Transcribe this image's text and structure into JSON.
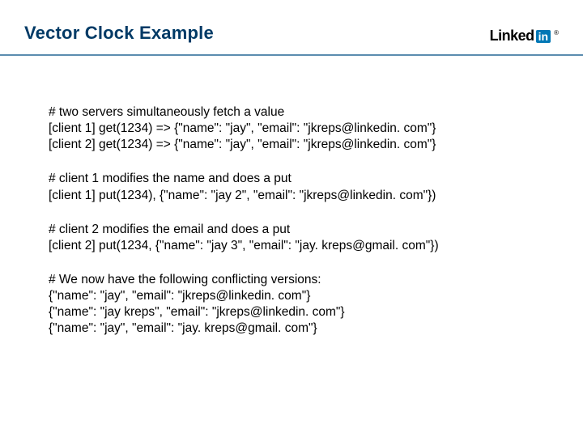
{
  "header": {
    "title": "Vector Clock Example",
    "logo": {
      "text": "Linked",
      "badge": "in",
      "dot": "®"
    }
  },
  "blocks": {
    "b1": {
      "l1": "# two servers simultaneously fetch a value",
      "l2": "[client 1] get(1234) => {\"name\": \"jay\", \"email\": \"jkreps@linkedin. com\"}",
      "l3": "[client 2] get(1234) => {\"name\": \"jay\", \"email\": \"jkreps@linkedin. com\"}"
    },
    "b2": {
      "l1": "# client 1 modifies the name and does a put",
      "l2": "[client 1] put(1234), {\"name\": \"jay 2\", \"email\": \"jkreps@linkedin. com\"})"
    },
    "b3": {
      "l1": "# client 2 modifies the email and does a put",
      "l2": "[client 2] put(1234, {\"name\": \"jay 3\", \"email\": \"jay. kreps@gmail. com\"})"
    },
    "b4": {
      "l1": "# We now have the following conflicting versions:",
      "l2": "{\"name\": \"jay\", \"email\": \"jkreps@linkedin. com\"}",
      "l3": "{\"name\": \"jay kreps\", \"email\": \"jkreps@linkedin. com\"}",
      "l4": "{\"name\": \"jay\", \"email\": \"jay. kreps@gmail. com\"}"
    }
  }
}
